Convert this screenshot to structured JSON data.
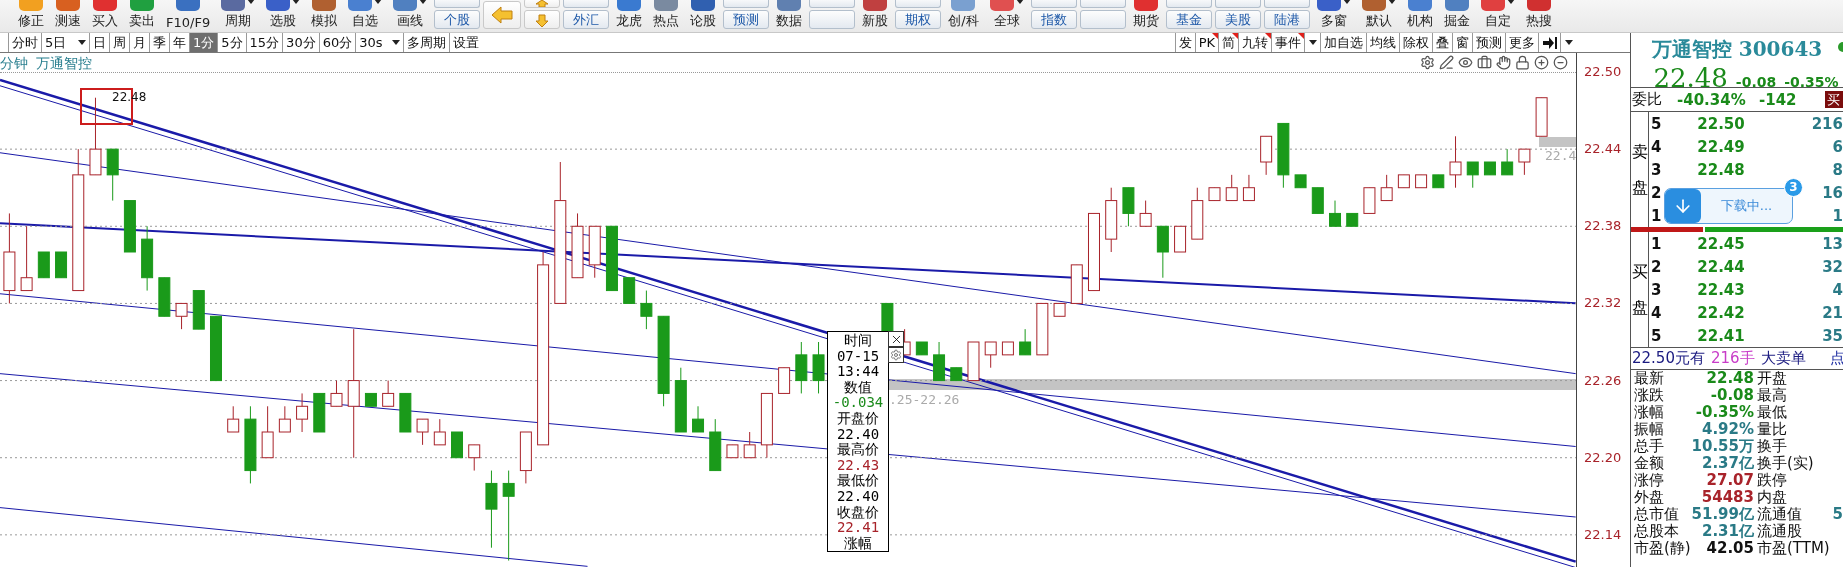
{
  "toolbar": {
    "items": [
      {
        "kind": "tool",
        "label": "修正",
        "has_menu": false
      },
      {
        "kind": "tool",
        "label": "测速",
        "has_menu": false
      },
      {
        "kind": "tool",
        "label": "买入",
        "has_menu": false
      },
      {
        "kind": "tool",
        "label": "卖出",
        "has_menu": false
      },
      {
        "kind": "tool",
        "label": "F10/F9",
        "has_menu": false
      },
      {
        "kind": "tool",
        "label": "周期",
        "has_menu": true
      },
      {
        "kind": "tool",
        "label": "选股",
        "has_menu": true
      },
      {
        "kind": "tool",
        "label": "模拟",
        "has_menu": false
      },
      {
        "kind": "tool",
        "label": "自选",
        "has_menu": true
      },
      {
        "kind": "tool",
        "label": "画线",
        "has_menu": true
      },
      {
        "kind": "stack",
        "label": "个股"
      },
      {
        "kind": "back"
      },
      {
        "kind": "updown"
      },
      {
        "kind": "stack",
        "label": "外汇"
      },
      {
        "kind": "tool",
        "label": "龙虎",
        "has_menu": false
      },
      {
        "kind": "tool",
        "label": "热点",
        "has_menu": false
      },
      {
        "kind": "tool",
        "label": "论股",
        "has_menu": false
      },
      {
        "kind": "stack",
        "label": "预测"
      },
      {
        "kind": "tool",
        "label": "数据",
        "has_menu": false
      },
      {
        "kind": "stack"
      },
      {
        "kind": "tool",
        "label": "新股",
        "has_menu": false
      },
      {
        "kind": "stack",
        "label": "期权"
      },
      {
        "kind": "tool",
        "label": "创/科",
        "has_menu": false
      },
      {
        "kind": "tool",
        "label": "全球",
        "has_menu": true
      },
      {
        "kind": "stack",
        "label": "指数"
      },
      {
        "kind": "stack"
      },
      {
        "kind": "tool",
        "label": "期货",
        "has_menu": false
      },
      {
        "kind": "stack",
        "label": "基金"
      },
      {
        "kind": "stack",
        "label": "美股"
      },
      {
        "kind": "stack",
        "label": "陆港"
      },
      {
        "kind": "tool",
        "label": "多窗",
        "has_menu": true
      },
      {
        "kind": "tool",
        "label": "默认",
        "has_menu": true
      },
      {
        "kind": "tool",
        "label": "机构",
        "has_menu": false
      },
      {
        "kind": "tool",
        "label": "掘金",
        "has_menu": false
      },
      {
        "kind": "tool",
        "label": "自定",
        "has_menu": true
      },
      {
        "kind": "tool",
        "label": "热搜",
        "has_menu": false
      }
    ]
  },
  "period_tabs": [
    {
      "label": "分时",
      "selected": false,
      "dropdown": false
    },
    {
      "label": "5日",
      "selected": false,
      "dropdown": true
    },
    {
      "label": "日",
      "selected": false,
      "dropdown": false
    },
    {
      "label": "周",
      "selected": false,
      "dropdown": false
    },
    {
      "label": "月",
      "selected": false,
      "dropdown": false
    },
    {
      "label": "季",
      "selected": false,
      "dropdown": false
    },
    {
      "label": "年",
      "selected": false,
      "dropdown": false
    },
    {
      "label": "1分",
      "selected": true,
      "dropdown": false
    },
    {
      "label": "5分",
      "selected": false,
      "dropdown": false
    },
    {
      "label": "15分",
      "selected": false,
      "dropdown": false
    },
    {
      "label": "30分",
      "selected": false,
      "dropdown": false
    },
    {
      "label": "60分",
      "selected": false,
      "dropdown": false
    },
    {
      "label": "30s",
      "selected": false,
      "dropdown": true
    },
    {
      "label": "多周期",
      "selected": false,
      "dropdown": false
    },
    {
      "label": "设置",
      "selected": false,
      "dropdown": false
    }
  ],
  "chart_tools": [
    {
      "kind": "text",
      "label": "发",
      "flag": false
    },
    {
      "kind": "text",
      "label": "PK",
      "flag": true
    },
    {
      "kind": "text",
      "label": "简",
      "flag": true
    },
    {
      "kind": "text",
      "label": "九转",
      "flag": true
    },
    {
      "kind": "text",
      "label": "事件",
      "flag": true
    },
    {
      "kind": "caret"
    },
    {
      "kind": "text",
      "label": "加自选",
      "flag": false
    },
    {
      "kind": "text",
      "label": "均线",
      "flag": false
    },
    {
      "kind": "text",
      "label": "除权",
      "flag": false
    },
    {
      "kind": "text",
      "label": "叠",
      "flag": false
    },
    {
      "kind": "text",
      "label": "窗",
      "flag": false
    },
    {
      "kind": "text",
      "label": "预测",
      "flag": false
    },
    {
      "kind": "text",
      "label": "更多",
      "flag": false
    },
    {
      "kind": "pin"
    },
    {
      "kind": "caret"
    }
  ],
  "chart": {
    "title_period": "分钟",
    "title_stock": "万通智控",
    "chart_data": {
      "type": "candlestick",
      "ylim": [
        22.115,
        22.5
      ],
      "grid": true,
      "yticks": [
        {
          "value": 22.5,
          "label": "22.50"
        },
        {
          "value": 22.44,
          "label": "22.44"
        },
        {
          "value": 22.38,
          "label": "22.38"
        },
        {
          "value": 22.32,
          "label": "22.32"
        },
        {
          "value": 22.26,
          "label": "22.26"
        },
        {
          "value": 22.2,
          "label": "22.20"
        },
        {
          "value": 22.14,
          "label": "22.14"
        }
      ],
      "ohlc": [
        [
          22.33,
          22.39,
          22.32,
          22.36
        ],
        [
          22.33,
          22.38,
          22.33,
          22.34
        ],
        [
          22.36,
          22.36,
          22.34,
          22.34
        ],
        [
          22.36,
          22.36,
          22.34,
          22.34
        ],
        [
          22.33,
          22.44,
          22.33,
          22.42
        ],
        [
          22.42,
          22.48,
          22.42,
          22.44
        ],
        [
          22.44,
          22.44,
          22.4,
          22.42
        ],
        [
          22.4,
          22.4,
          22.36,
          22.36
        ],
        [
          22.37,
          22.38,
          22.33,
          22.34
        ],
        [
          22.34,
          22.34,
          22.31,
          22.31
        ],
        [
          22.31,
          22.32,
          22.3,
          22.32
        ],
        [
          22.33,
          22.33,
          22.3,
          22.3
        ],
        [
          22.31,
          22.31,
          22.26,
          22.26
        ],
        [
          22.22,
          22.24,
          22.22,
          22.23
        ],
        [
          22.23,
          22.24,
          22.18,
          22.19
        ],
        [
          22.2,
          22.24,
          22.2,
          22.22
        ],
        [
          22.22,
          22.24,
          22.22,
          22.23
        ],
        [
          22.23,
          22.25,
          22.22,
          22.24
        ],
        [
          22.25,
          22.25,
          22.22,
          22.22
        ],
        [
          22.24,
          22.26,
          22.24,
          22.25
        ],
        [
          22.24,
          22.3,
          22.2,
          22.26
        ],
        [
          22.25,
          22.25,
          22.24,
          22.24
        ],
        [
          22.24,
          22.26,
          22.24,
          22.25
        ],
        [
          22.25,
          22.25,
          22.22,
          22.22
        ],
        [
          22.22,
          22.23,
          22.21,
          22.23
        ],
        [
          22.21,
          22.23,
          22.21,
          22.22
        ],
        [
          22.22,
          22.22,
          22.2,
          22.2
        ],
        [
          22.2,
          22.21,
          22.19,
          22.21
        ],
        [
          22.18,
          22.19,
          22.13,
          22.16
        ],
        [
          22.18,
          22.19,
          22.12,
          22.17
        ],
        [
          22.19,
          22.22,
          22.18,
          22.22
        ],
        [
          22.21,
          22.36,
          22.21,
          22.35
        ],
        [
          22.32,
          22.43,
          22.32,
          22.4
        ],
        [
          22.34,
          22.39,
          22.34,
          22.38
        ],
        [
          22.35,
          22.38,
          22.34,
          22.38
        ],
        [
          22.38,
          22.38,
          22.33,
          22.33
        ],
        [
          22.34,
          22.34,
          22.32,
          22.32
        ],
        [
          22.32,
          22.33,
          22.3,
          22.31
        ],
        [
          22.31,
          22.31,
          22.24,
          22.25
        ],
        [
          22.26,
          22.27,
          22.22,
          22.22
        ],
        [
          22.23,
          22.24,
          22.22,
          22.22
        ],
        [
          22.22,
          22.23,
          22.19,
          22.19
        ],
        [
          22.2,
          22.21,
          22.2,
          22.21
        ],
        [
          22.2,
          22.22,
          22.2,
          22.21
        ],
        [
          22.21,
          22.25,
          22.2,
          22.25
        ],
        [
          22.25,
          22.27,
          22.25,
          22.27
        ],
        [
          22.28,
          22.29,
          22.25,
          22.26
        ],
        [
          22.28,
          22.29,
          22.25,
          22.26
        ],
        null,
        null,
        null,
        [
          22.32,
          22.32,
          22.28,
          22.28
        ],
        [
          22.28,
          22.3,
          22.28,
          22.29
        ],
        [
          22.29,
          22.29,
          22.28,
          22.28
        ],
        [
          22.28,
          22.29,
          22.26,
          22.26
        ],
        [
          22.27,
          22.27,
          22.26,
          22.26
        ],
        [
          22.26,
          22.29,
          22.26,
          22.29
        ],
        [
          22.28,
          22.29,
          22.27,
          22.29
        ],
        [
          22.28,
          22.29,
          22.28,
          22.29
        ],
        [
          22.29,
          22.3,
          22.28,
          22.28
        ],
        [
          22.28,
          22.32,
          22.28,
          22.32
        ],
        [
          22.31,
          22.32,
          22.31,
          22.32
        ],
        [
          22.32,
          22.35,
          22.32,
          22.35
        ],
        [
          22.33,
          22.39,
          22.33,
          22.39
        ],
        [
          22.37,
          22.41,
          22.36,
          22.4
        ],
        [
          22.41,
          22.41,
          22.38,
          22.39
        ],
        [
          22.38,
          22.4,
          22.38,
          22.39
        ],
        [
          22.38,
          22.38,
          22.34,
          22.36
        ],
        [
          22.36,
          22.38,
          22.36,
          22.38
        ],
        [
          22.37,
          22.41,
          22.37,
          22.4
        ],
        [
          22.4,
          22.41,
          22.4,
          22.41
        ],
        [
          22.4,
          22.42,
          22.4,
          22.41
        ],
        [
          22.4,
          22.42,
          22.4,
          22.41
        ],
        [
          22.43,
          22.45,
          22.42,
          22.45
        ],
        [
          22.46,
          22.46,
          22.41,
          22.42
        ],
        [
          22.42,
          22.42,
          22.41,
          22.41
        ],
        [
          22.41,
          22.41,
          22.39,
          22.39
        ],
        [
          22.39,
          22.4,
          22.38,
          22.38
        ],
        [
          22.39,
          22.39,
          22.38,
          22.38
        ],
        [
          22.39,
          22.41,
          22.39,
          22.41
        ],
        [
          22.4,
          22.42,
          22.4,
          22.41
        ],
        [
          22.41,
          22.42,
          22.41,
          22.42
        ],
        [
          22.41,
          22.42,
          22.41,
          22.42
        ],
        [
          22.42,
          22.42,
          22.41,
          22.41
        ],
        [
          22.42,
          22.45,
          22.41,
          22.43
        ],
        [
          22.43,
          22.43,
          22.41,
          22.42
        ],
        [
          22.43,
          22.43,
          22.42,
          22.42
        ],
        [
          22.43,
          22.44,
          22.42,
          22.42
        ],
        [
          22.43,
          22.44,
          22.42,
          22.44
        ],
        [
          22.45,
          22.48,
          22.45,
          22.48
        ]
      ]
    },
    "band_labels": [
      ".25-22.26",
      "22.4"
    ],
    "marker_label": "22.48",
    "tooltip": {
      "lines": [
        {
          "text": "时间",
          "kind": "label"
        },
        {
          "text": "07-15",
          "kind": "value",
          "color": "#000000"
        },
        {
          "text": "13:44",
          "kind": "value",
          "color": "#000000"
        },
        {
          "text": "数值",
          "kind": "label"
        },
        {
          "text": "-0.034",
          "kind": "value",
          "color": "#1a8a1a"
        },
        {
          "text": "开盘价",
          "kind": "label"
        },
        {
          "text": "22.40",
          "kind": "value",
          "color": "#000000"
        },
        {
          "text": "最高价",
          "kind": "label"
        },
        {
          "text": "22.43",
          "kind": "value",
          "color": "#a8232a"
        },
        {
          "text": "最低价",
          "kind": "label"
        },
        {
          "text": "22.40",
          "kind": "value",
          "color": "#000000"
        },
        {
          "text": "收盘价",
          "kind": "label"
        },
        {
          "text": "22.41",
          "kind": "value",
          "color": "#a8232a"
        },
        {
          "text": "涨幅",
          "kind": "label"
        }
      ]
    }
  },
  "quote": {
    "name": "万通智控 300643",
    "price": "22.48",
    "change": "-0.08",
    "change_pct": "-0.35%",
    "ratio_label": "委比",
    "ratio": "-40.34%",
    "diff": "-142",
    "buy_button": "买",
    "sell_label": "卖盘",
    "buy_label": "买盘",
    "sell_rows": [
      {
        "level": "5",
        "price": "22.50",
        "volume": "216"
      },
      {
        "level": "4",
        "price": "22.49",
        "volume": "6"
      },
      {
        "level": "3",
        "price": "22.48",
        "volume": "8"
      },
      {
        "level": "2",
        "volume": "16"
      },
      {
        "level": "1",
        "volume": "1"
      }
    ],
    "ratio_bar": {
      "level": 0.35
    },
    "buy_rows": [
      {
        "level": "1",
        "price": "22.45",
        "volume": "13"
      },
      {
        "level": "2",
        "price": "22.44",
        "volume": "32"
      },
      {
        "level": "3",
        "price": "22.43",
        "volume": "4"
      },
      {
        "level": "4",
        "price": "22.42",
        "volume": "21"
      },
      {
        "level": "5",
        "price": "22.41",
        "volume": "35"
      }
    ],
    "big_order": {
      "price_text": "22.50元有",
      "hands": "216手",
      "type": "大卖单",
      "link": "点"
    },
    "download": {
      "text": "下载中...",
      "badge": "3"
    },
    "stats": [
      {
        "label": "最新",
        "value": "22.48",
        "color": "#1a8a1a",
        "label2": "开盘"
      },
      {
        "label": "涨跌",
        "value": "-0.08",
        "color": "#1a8a1a",
        "label2": "最高"
      },
      {
        "label": "涨幅",
        "value": "-0.35%",
        "color": "#1a8a1a",
        "label2": "最低"
      },
      {
        "label": "振幅",
        "value": "4.92%",
        "color": "#2a7a86",
        "label2": "量比"
      },
      {
        "label": "总手",
        "value": "10.55万",
        "color": "#2a7a86",
        "label2": "换手"
      },
      {
        "label": "金额",
        "value": "2.37亿",
        "color": "#2a7a86",
        "label2": "换手(实)"
      },
      {
        "label": "涨停",
        "value": "27.07",
        "color": "#a8232a",
        "label2": "跌停"
      },
      {
        "label": "外盘",
        "value": "54483",
        "color": "#a8232a",
        "label2": "内盘"
      },
      {
        "label": "总市值",
        "value": "51.99亿",
        "color": "#2a7a86",
        "label2": "流通值",
        "value2": "5"
      },
      {
        "label": "总股本",
        "value": "2.31亿",
        "color": "#2a7a86",
        "label2": "流通股"
      },
      {
        "label": "市盈(静)",
        "value": "42.05",
        "color": "#111111",
        "label2": "市盈(TTM)"
      }
    ]
  }
}
